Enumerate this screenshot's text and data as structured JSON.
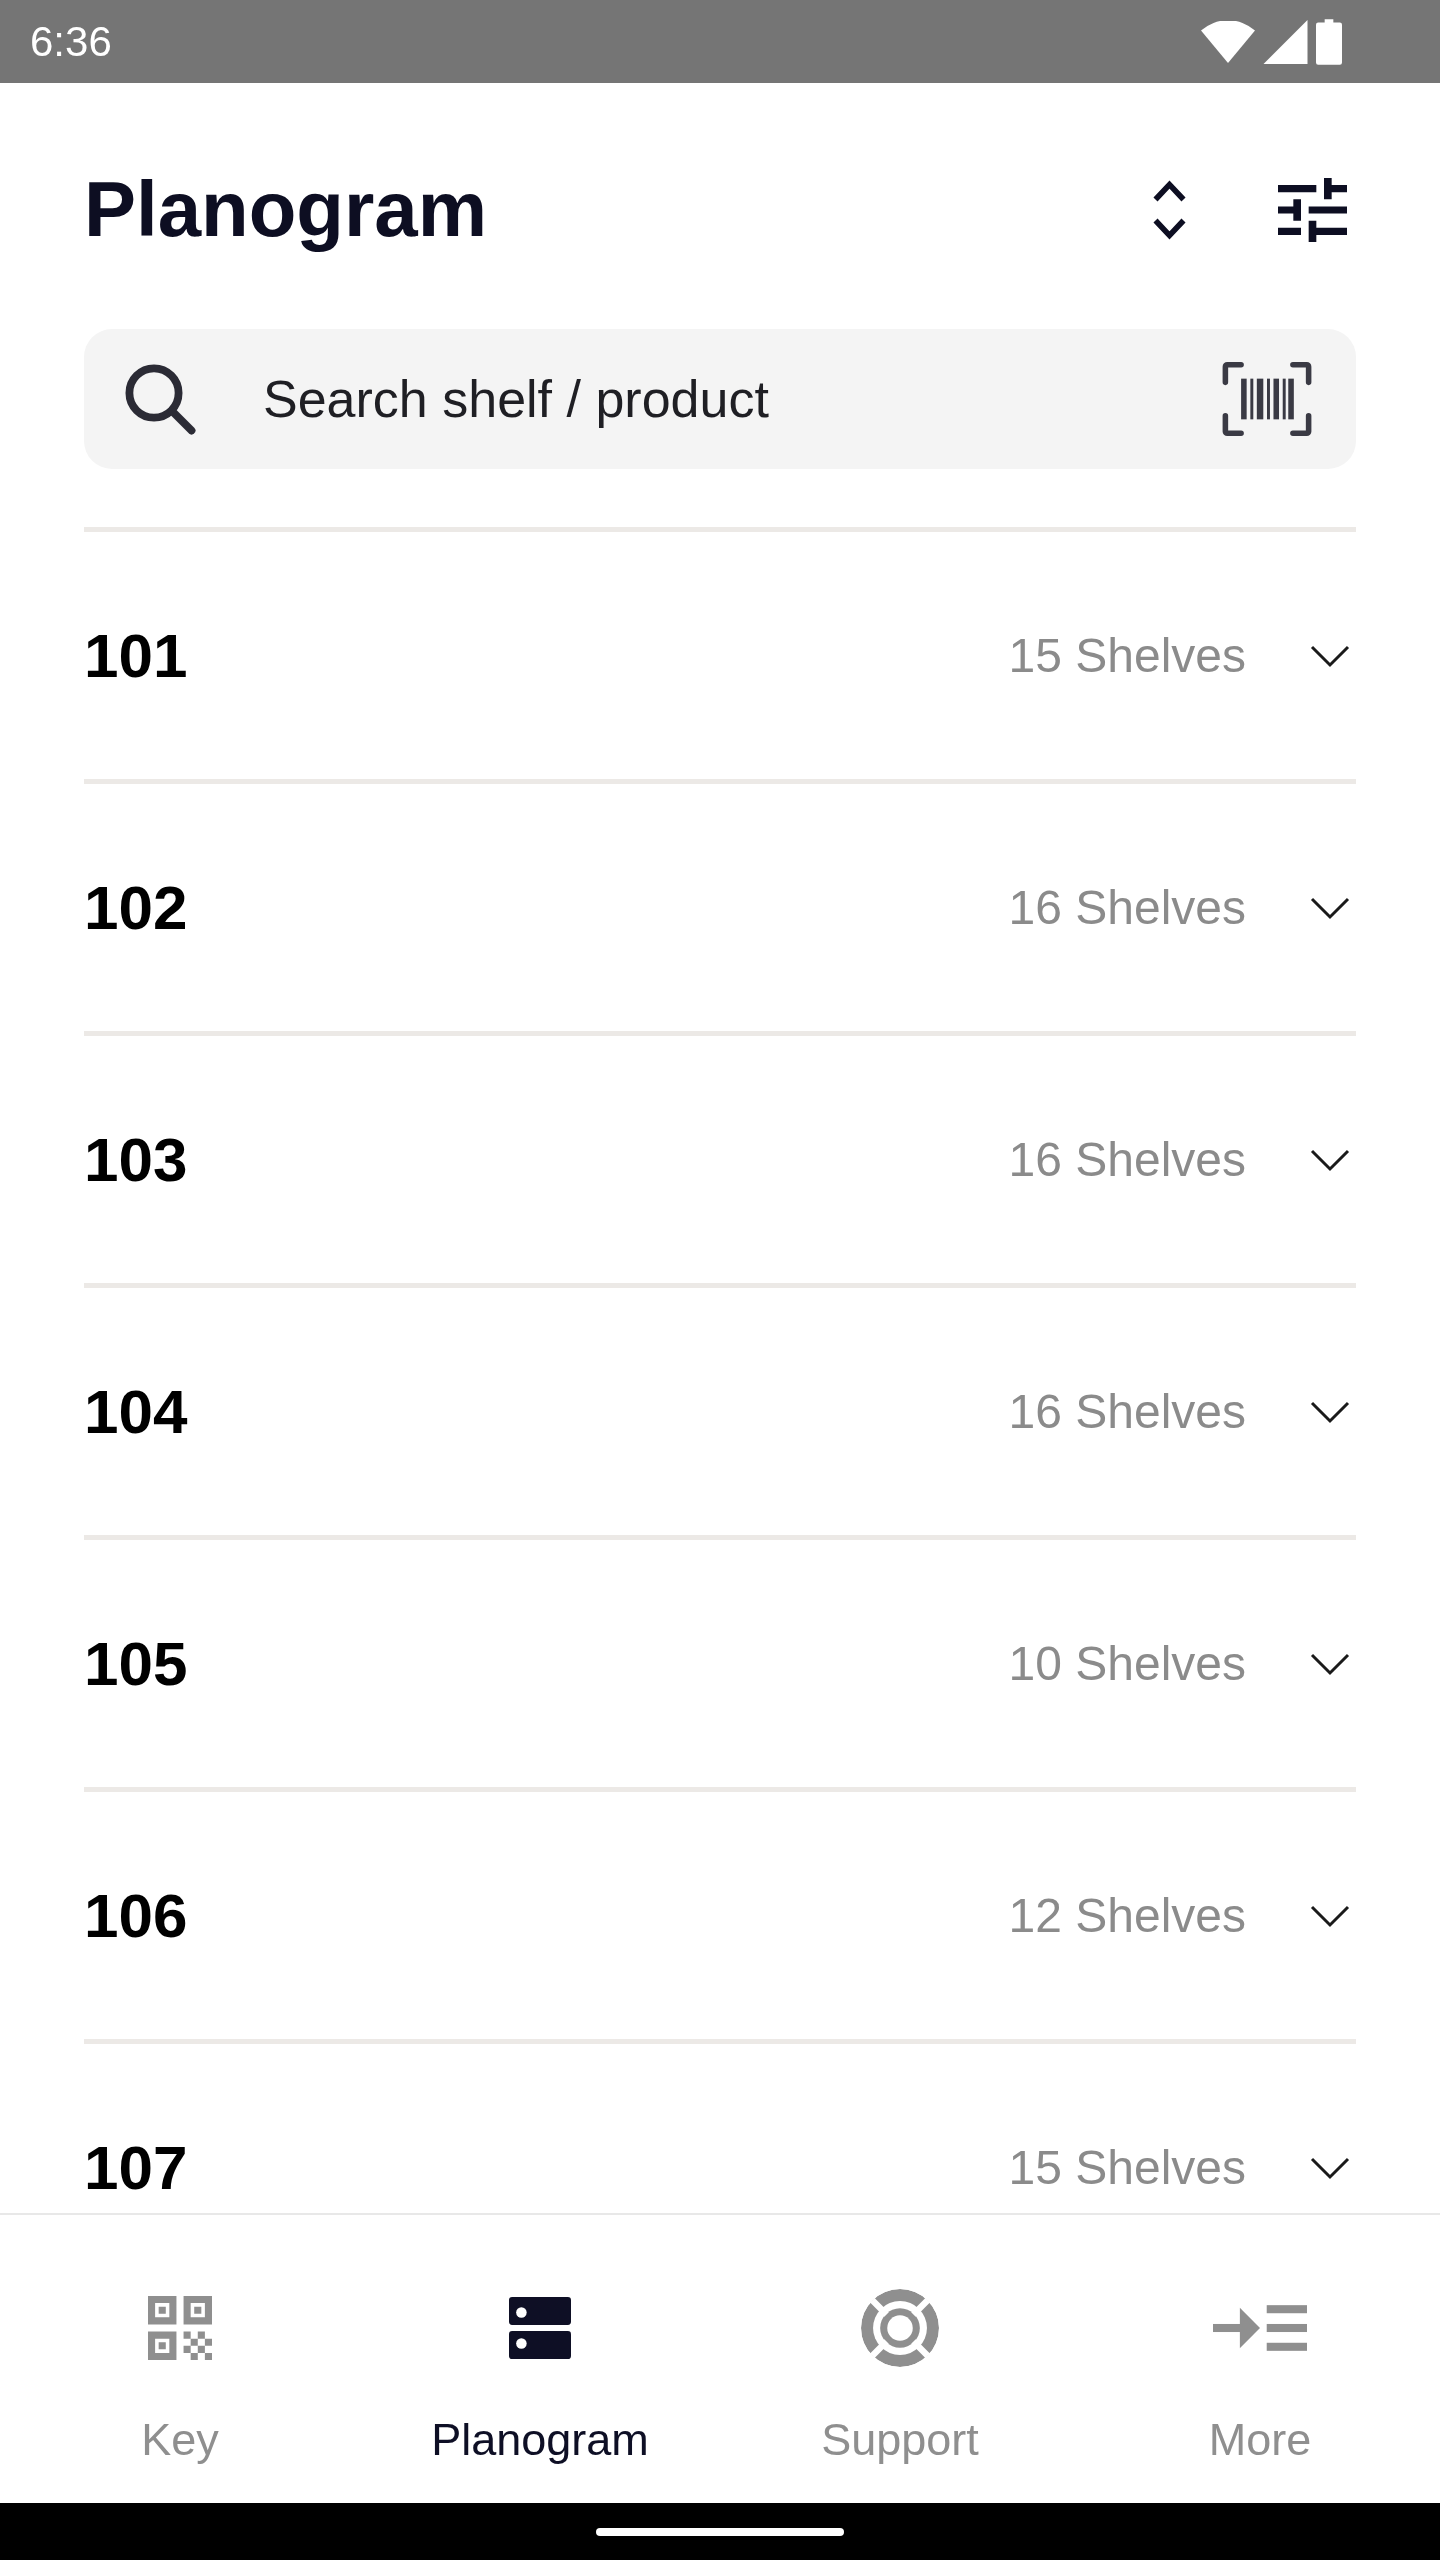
{
  "status_bar": {
    "time": "6:36"
  },
  "header": {
    "title": "Planogram"
  },
  "search": {
    "placeholder": "Search shelf / product"
  },
  "aisles": [
    {
      "number": "101",
      "shelves": "15 Shelves",
      "expanded": false
    },
    {
      "number": "102",
      "shelves": "16 Shelves",
      "expanded": false
    },
    {
      "number": "103",
      "shelves": "16 Shelves",
      "expanded": false
    },
    {
      "number": "104",
      "shelves": "16 Shelves",
      "expanded": false
    },
    {
      "number": "105",
      "shelves": "10 Shelves",
      "expanded": false
    },
    {
      "number": "106",
      "shelves": "12 Shelves",
      "expanded": false
    },
    {
      "number": "107",
      "shelves": "15 Shelves",
      "expanded": false
    }
  ],
  "bottom_nav": [
    {
      "label": "Key",
      "selected": false
    },
    {
      "label": "Planogram",
      "selected": true
    },
    {
      "label": "Support",
      "selected": false
    },
    {
      "label": "More",
      "selected": false
    }
  ]
}
